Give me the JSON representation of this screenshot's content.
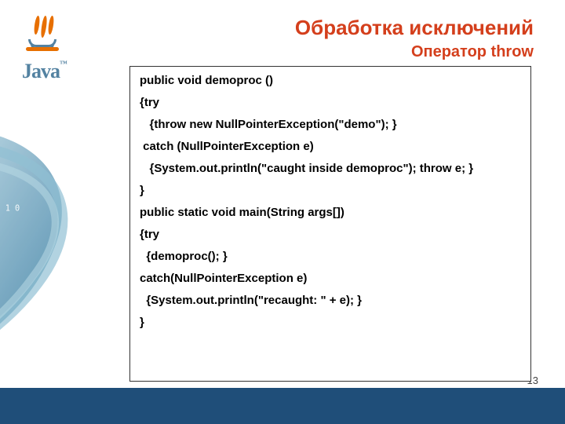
{
  "logo": {
    "text": "Java",
    "trademark": "™"
  },
  "title": {
    "main": "Обработка исключений",
    "sub": "Оператор throw"
  },
  "code": {
    "lines": [
      "public void demoproc ()",
      "{try",
      "   {throw new NullPointerException(\"demo\"); }",
      " catch (NullPointerException e)",
      "   {System.out.println(\"caught inside demoproc\"); throw e; }",
      "}",
      "public static void main(String args[])",
      "{try",
      "  {demoproc(); }",
      "catch(NullPointerException e)",
      "  {System.out.println(\"recaught: \" + e); }",
      "}"
    ]
  },
  "page_number": "13",
  "colors": {
    "accent": "#d43f1c",
    "footer": "#1f4e79",
    "java_blue": "#5382a1",
    "java_orange": "#e76f00"
  }
}
